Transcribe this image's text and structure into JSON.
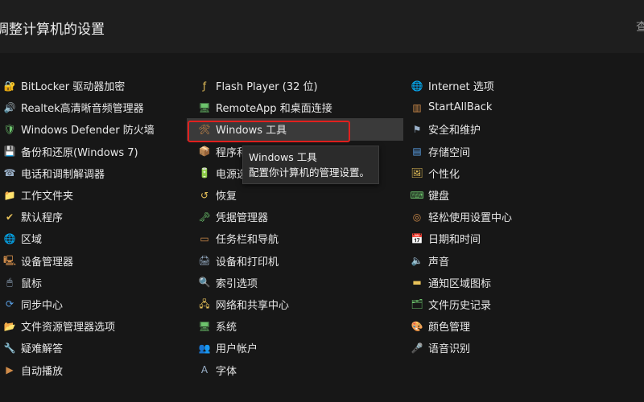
{
  "header": {
    "title": "调整计算机的设置",
    "view_by": "查"
  },
  "columns": [
    [
      {
        "label": "BitLocker 驱动器加密",
        "icon": "bitlocker-icon",
        "glyph": "🔐"
      },
      {
        "label": "Realtek高清晰音频管理器",
        "icon": "audio-manager-icon",
        "glyph": "🔊"
      },
      {
        "label": "Windows Defender 防火墙",
        "icon": "firewall-icon",
        "glyph": "🛡"
      },
      {
        "label": "备份和还原(Windows 7)",
        "icon": "backup-icon",
        "glyph": "💾"
      },
      {
        "label": "电话和调制解调器",
        "icon": "phone-modem-icon",
        "glyph": "☎"
      },
      {
        "label": "工作文件夹",
        "icon": "work-folders-icon",
        "glyph": "📁"
      },
      {
        "label": "默认程序",
        "icon": "default-programs-icon",
        "glyph": "✔"
      },
      {
        "label": "区域",
        "icon": "region-icon",
        "glyph": "🌐"
      },
      {
        "label": "设备管理器",
        "icon": "device-manager-icon",
        "glyph": "🖳"
      },
      {
        "label": "鼠标",
        "icon": "mouse-icon",
        "glyph": "🖱"
      },
      {
        "label": "同步中心",
        "icon": "sync-center-icon",
        "glyph": "⟳"
      },
      {
        "label": "文件资源管理器选项",
        "icon": "folder-options-icon",
        "glyph": "📂"
      },
      {
        "label": "疑难解答",
        "icon": "troubleshoot-icon",
        "glyph": "🔧"
      },
      {
        "label": "自动播放",
        "icon": "autoplay-icon",
        "glyph": "▶"
      }
    ],
    [
      {
        "label": "Flash Player (32 位)",
        "icon": "flash-player-icon",
        "glyph": "ƒ"
      },
      {
        "label": "RemoteApp 和桌面连接",
        "icon": "remoteapp-icon",
        "glyph": "🖥"
      },
      {
        "label": "Windows 工具",
        "icon": "windows-tools-icon",
        "glyph": "🛠"
      },
      {
        "label": "程序和功能",
        "icon": "programs-features-icon",
        "glyph": "📦"
      },
      {
        "label": "电源选项",
        "icon": "power-options-icon",
        "glyph": "🔋"
      },
      {
        "label": "恢复",
        "icon": "recovery-icon",
        "glyph": "↺"
      },
      {
        "label": "凭据管理器",
        "icon": "credential-manager-icon",
        "glyph": "🗝"
      },
      {
        "label": "任务栏和导航",
        "icon": "taskbar-icon",
        "glyph": "▭"
      },
      {
        "label": "设备和打印机",
        "icon": "printer-icon",
        "glyph": "🖨"
      },
      {
        "label": "索引选项",
        "icon": "indexing-icon",
        "glyph": "🔍"
      },
      {
        "label": "网络和共享中心",
        "icon": "network-icon",
        "glyph": "🖧"
      },
      {
        "label": "系统",
        "icon": "system-icon",
        "glyph": "🖥"
      },
      {
        "label": "用户帐户",
        "icon": "user-accounts-icon",
        "glyph": "👥"
      },
      {
        "label": "字体",
        "icon": "fonts-icon",
        "glyph": "A"
      }
    ],
    [
      {
        "label": "Internet 选项",
        "icon": "internet-options-icon",
        "glyph": "🌐"
      },
      {
        "label": "StartAllBack",
        "icon": "startallback-icon",
        "glyph": "▥"
      },
      {
        "label": "安全和维护",
        "icon": "security-maintenance-icon",
        "glyph": "⚑"
      },
      {
        "label": "存储空间",
        "icon": "storage-spaces-icon",
        "glyph": "▤"
      },
      {
        "label": "个性化",
        "icon": "personalization-icon",
        "glyph": "🖼"
      },
      {
        "label": "键盘",
        "icon": "keyboard-icon",
        "glyph": "⌨"
      },
      {
        "label": "轻松使用设置中心",
        "icon": "ease-of-access-icon",
        "glyph": "◎"
      },
      {
        "label": "日期和时间",
        "icon": "date-time-icon",
        "glyph": "📅"
      },
      {
        "label": "声音",
        "icon": "sound-icon",
        "glyph": "🔈"
      },
      {
        "label": "通知区域图标",
        "icon": "notification-area-icon",
        "glyph": "▬"
      },
      {
        "label": "文件历史记录",
        "icon": "file-history-icon",
        "glyph": "🗂"
      },
      {
        "label": "颜色管理",
        "icon": "color-management-icon",
        "glyph": "🎨"
      },
      {
        "label": "语音识别",
        "icon": "speech-recognition-icon",
        "glyph": "🎤"
      }
    ]
  ],
  "tooltip": {
    "title": "Windows 工具",
    "description": "配置你计算机的管理设置。"
  },
  "colors": {
    "background": "#171717",
    "hover": "#3a3a3a",
    "highlight_box": "#e0201e"
  }
}
